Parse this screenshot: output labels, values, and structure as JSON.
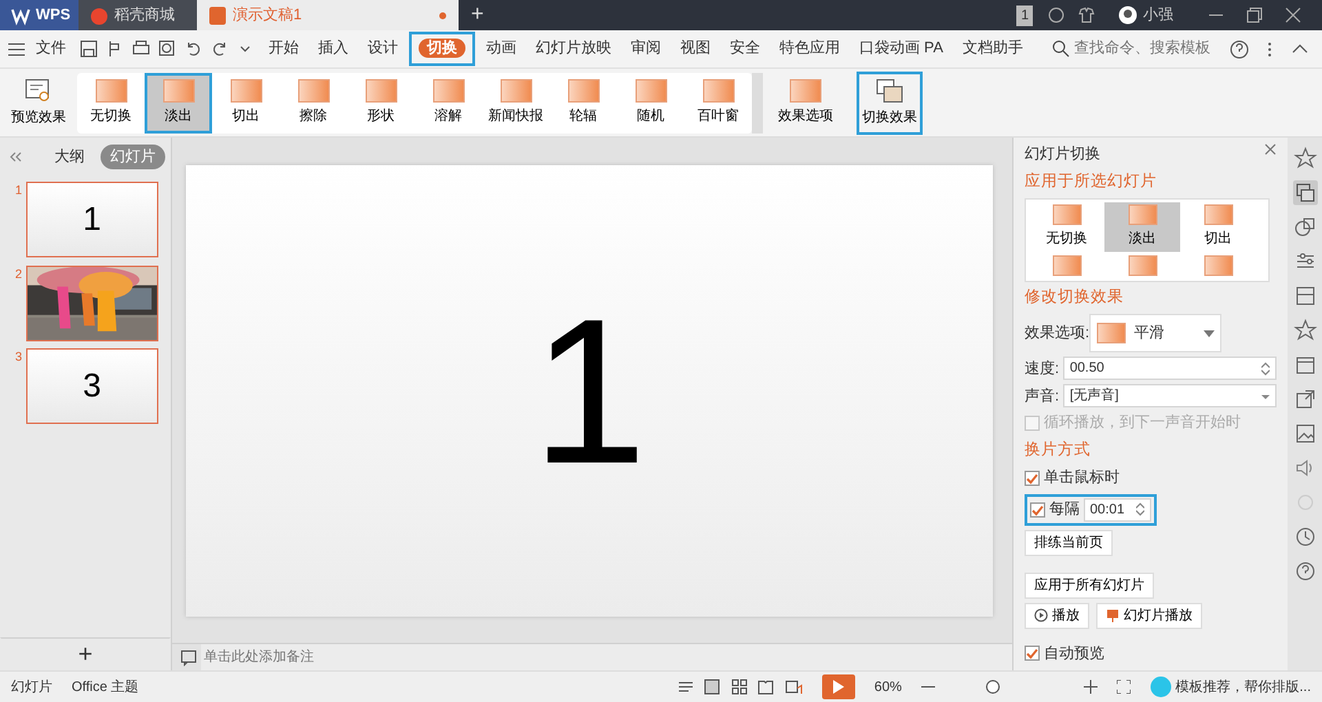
{
  "title_bar": {
    "tabs": [
      {
        "label": "WPS",
        "kind": "app",
        "selected": false
      },
      {
        "label": "稻壳商城",
        "kind": "store",
        "selected": false
      },
      {
        "label": "演示文稿1",
        "kind": "doc",
        "selected": true
      }
    ],
    "new_tab": "+",
    "badge": "1",
    "user": "小强"
  },
  "menu": {
    "file": "文件",
    "tabs": [
      {
        "label": "开始",
        "selected": false,
        "highlighted": false
      },
      {
        "label": "插入",
        "selected": false,
        "highlighted": false
      },
      {
        "label": "设计",
        "selected": false,
        "highlighted": false
      },
      {
        "label": "切换",
        "selected": true,
        "highlighted": true
      },
      {
        "label": "动画",
        "selected": false,
        "highlighted": false
      },
      {
        "label": "幻灯片放映",
        "selected": false,
        "highlighted": false
      },
      {
        "label": "审阅",
        "selected": false,
        "highlighted": false
      },
      {
        "label": "视图",
        "selected": false,
        "highlighted": false
      },
      {
        "label": "安全",
        "selected": false,
        "highlighted": false
      },
      {
        "label": "特色应用",
        "selected": false,
        "highlighted": false
      },
      {
        "label": "口袋动画 PA",
        "selected": false,
        "highlighted": false
      },
      {
        "label": "文档助手",
        "selected": false,
        "highlighted": false
      }
    ],
    "search_placeholder": "查找命令、搜索模板"
  },
  "ribbon": {
    "preview": "预览效果",
    "transitions": [
      {
        "label": "无切换",
        "selected": false,
        "highlighted": false
      },
      {
        "label": "淡出",
        "selected": true,
        "highlighted": true
      },
      {
        "label": "切出",
        "selected": false,
        "highlighted": false
      },
      {
        "label": "擦除",
        "selected": false,
        "highlighted": false
      },
      {
        "label": "形状",
        "selected": false,
        "highlighted": false
      },
      {
        "label": "溶解",
        "selected": false,
        "highlighted": false
      },
      {
        "label": "新闻快报",
        "selected": false,
        "highlighted": false
      },
      {
        "label": "轮辐",
        "selected": false,
        "highlighted": false
      },
      {
        "label": "随机",
        "selected": false,
        "highlighted": false
      },
      {
        "label": "百叶窗",
        "selected": false,
        "highlighted": false
      }
    ],
    "effect_options": "效果选项",
    "switch_effect": {
      "label": "切换效果",
      "highlighted": true
    }
  },
  "slides_panel": {
    "tabs": [
      {
        "label": "大纲",
        "selected": false
      },
      {
        "label": "幻灯片",
        "selected": true
      }
    ],
    "slides": [
      {
        "number": "1",
        "kind": "text",
        "text": "1"
      },
      {
        "number": "2",
        "kind": "picture"
      },
      {
        "number": "3",
        "kind": "text",
        "text": "3"
      }
    ],
    "add": "+"
  },
  "slide": {
    "text": "1"
  },
  "notes": {
    "placeholder": "单击此处添加备注"
  },
  "transition_pane": {
    "title": "幻灯片切换",
    "apply_heading": "应用于所选幻灯片",
    "gallery": [
      {
        "label": "无切换",
        "selected": false
      },
      {
        "label": "淡出",
        "selected": true
      },
      {
        "label": "切出",
        "selected": false
      }
    ],
    "modify_heading": "修改切换效果",
    "effect_label": "效果选项:",
    "effect_value": "平滑",
    "speed_label": "速度:",
    "speed": "00.50",
    "sound_label": "声音:",
    "sound": "[无声音]",
    "loop": {
      "label": "循环播放，到下一声音开始时",
      "checked": false,
      "disabled": true
    },
    "advance_heading": "换片方式",
    "on_click": {
      "label": "单击鼠标时",
      "checked": true
    },
    "every": {
      "label": "每隔",
      "value": "00:01",
      "checked": true,
      "highlighted": true
    },
    "rehearse": "排练当前页",
    "apply_all": "应用于所有幻灯片",
    "play": "播放",
    "slideshow": "幻灯片播放",
    "auto_preview": {
      "label": "自动预览",
      "checked": true
    }
  },
  "right_toolbar": [
    {
      "selected": false
    },
    {
      "selected": true
    },
    {
      "selected": false
    },
    {
      "selected": false
    },
    {
      "selected": false
    },
    {
      "selected": false
    },
    {
      "selected": false
    },
    {
      "selected": false
    },
    {
      "selected": false
    },
    {
      "selected": false
    },
    {
      "selected": false
    },
    {
      "selected": false
    },
    {
      "selected": false
    }
  ],
  "status_bar": {
    "slide_label": "幻灯片",
    "theme": "Office 主题",
    "zoom": "60%",
    "zoom_slider": {
      "level": 0.35
    },
    "tip": "模板推荐，帮你排版..."
  }
}
